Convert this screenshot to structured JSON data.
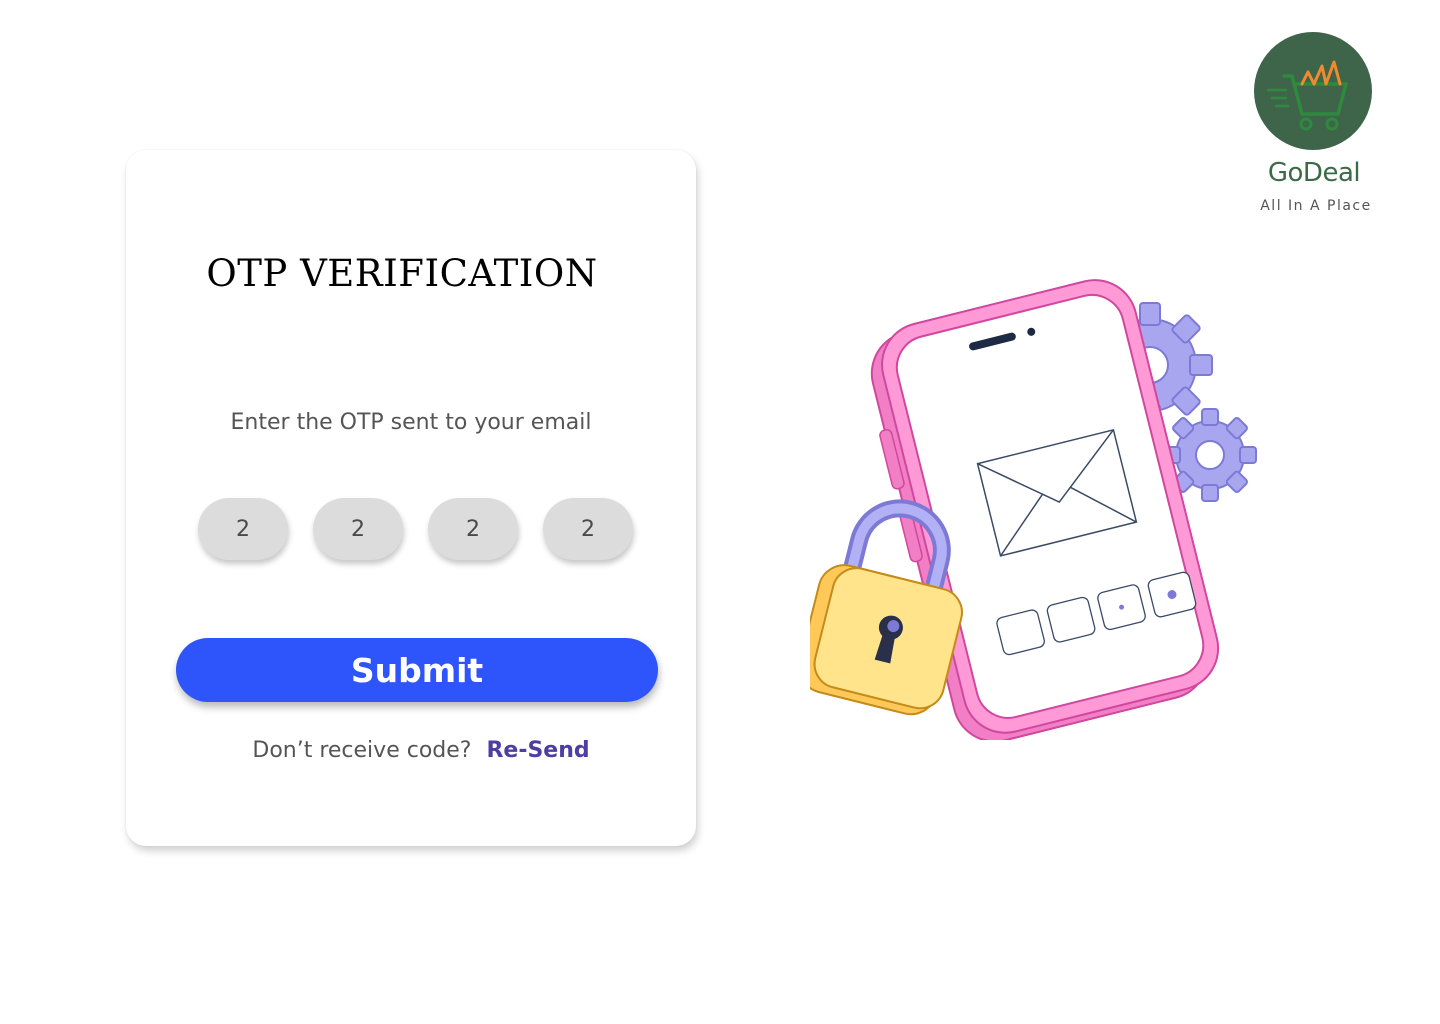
{
  "brand": {
    "name": "GoDeal",
    "tagline": "All In A Place",
    "logo_color": "#3e644a"
  },
  "otp_card": {
    "title": "OTP VERIFICATION",
    "instruction": "Enter the OTP sent to your email",
    "digits": [
      "2",
      "2",
      "2",
      "2"
    ],
    "submit_label": "Submit",
    "resend_prompt": "Don’t receive code?",
    "resend_link": "Re-Send"
  },
  "colors": {
    "primary_button": "#2d55fb",
    "resend_link": "#4e3ea1",
    "otp_box": "#dcdcdc"
  },
  "illustration": {
    "icons": [
      "phone-icon",
      "envelope-icon",
      "padlock-icon",
      "gear-icon"
    ]
  }
}
